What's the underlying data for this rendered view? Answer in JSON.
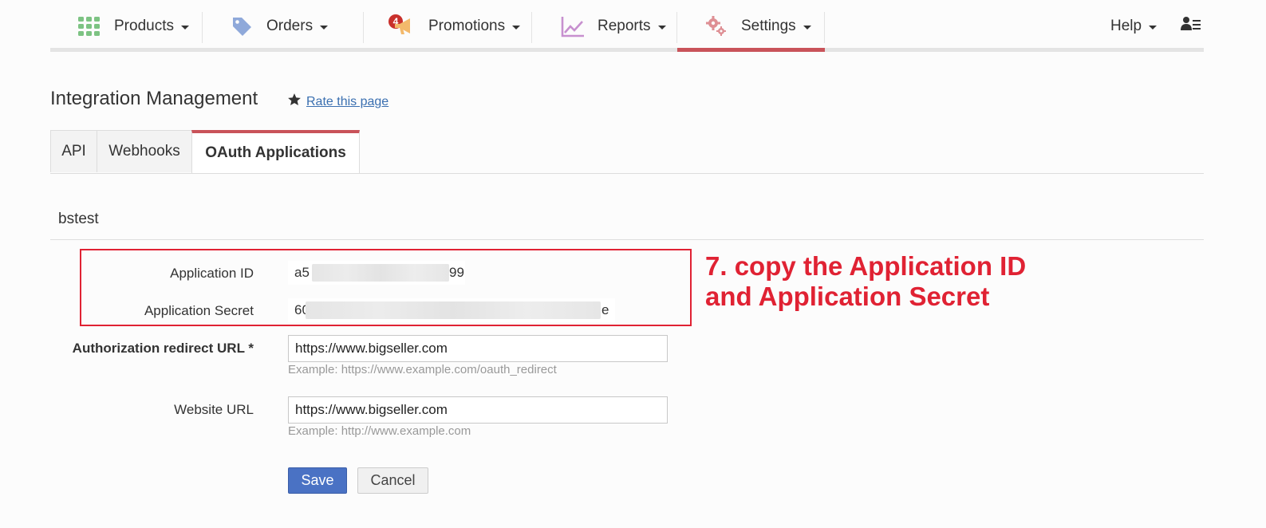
{
  "nav": {
    "products": "Products",
    "orders": "Orders",
    "orders_badge": "4",
    "promotions": "Promotions",
    "reports": "Reports",
    "settings": "Settings",
    "help": "Help",
    "icons": [
      "grid-icon",
      "tag-icon",
      "megaphone-icon",
      "chart-icon",
      "gear-icon",
      "user-list-icon"
    ],
    "active_color": "#c9535a"
  },
  "page": {
    "title": "Integration Management",
    "rate_link": "Rate this page"
  },
  "tabs": [
    {
      "label": "API",
      "active": false
    },
    {
      "label": "Webhooks",
      "active": false
    },
    {
      "label": "OAuth Applications",
      "active": true
    }
  ],
  "app": {
    "name": "bstest",
    "application_id_label": "Application ID",
    "application_id_prefix": "a5",
    "application_id_suffix": "99",
    "application_secret_label": "Application Secret",
    "application_secret_prefix": "60",
    "application_secret_suffix": "e",
    "redirect_label": "Authorization redirect URL *",
    "redirect_value": "https://www.bigseller.com",
    "redirect_hint": "Example: https://www.example.com/oauth_redirect",
    "website_label": "Website URL",
    "website_value": "https://www.bigseller.com",
    "website_hint": "Example: http://www.example.com"
  },
  "annotation": {
    "line1": "7. copy the Application ID",
    "line2": "and Application Secret",
    "color": "#e02233"
  },
  "buttons": {
    "save": "Save",
    "cancel": "Cancel"
  }
}
